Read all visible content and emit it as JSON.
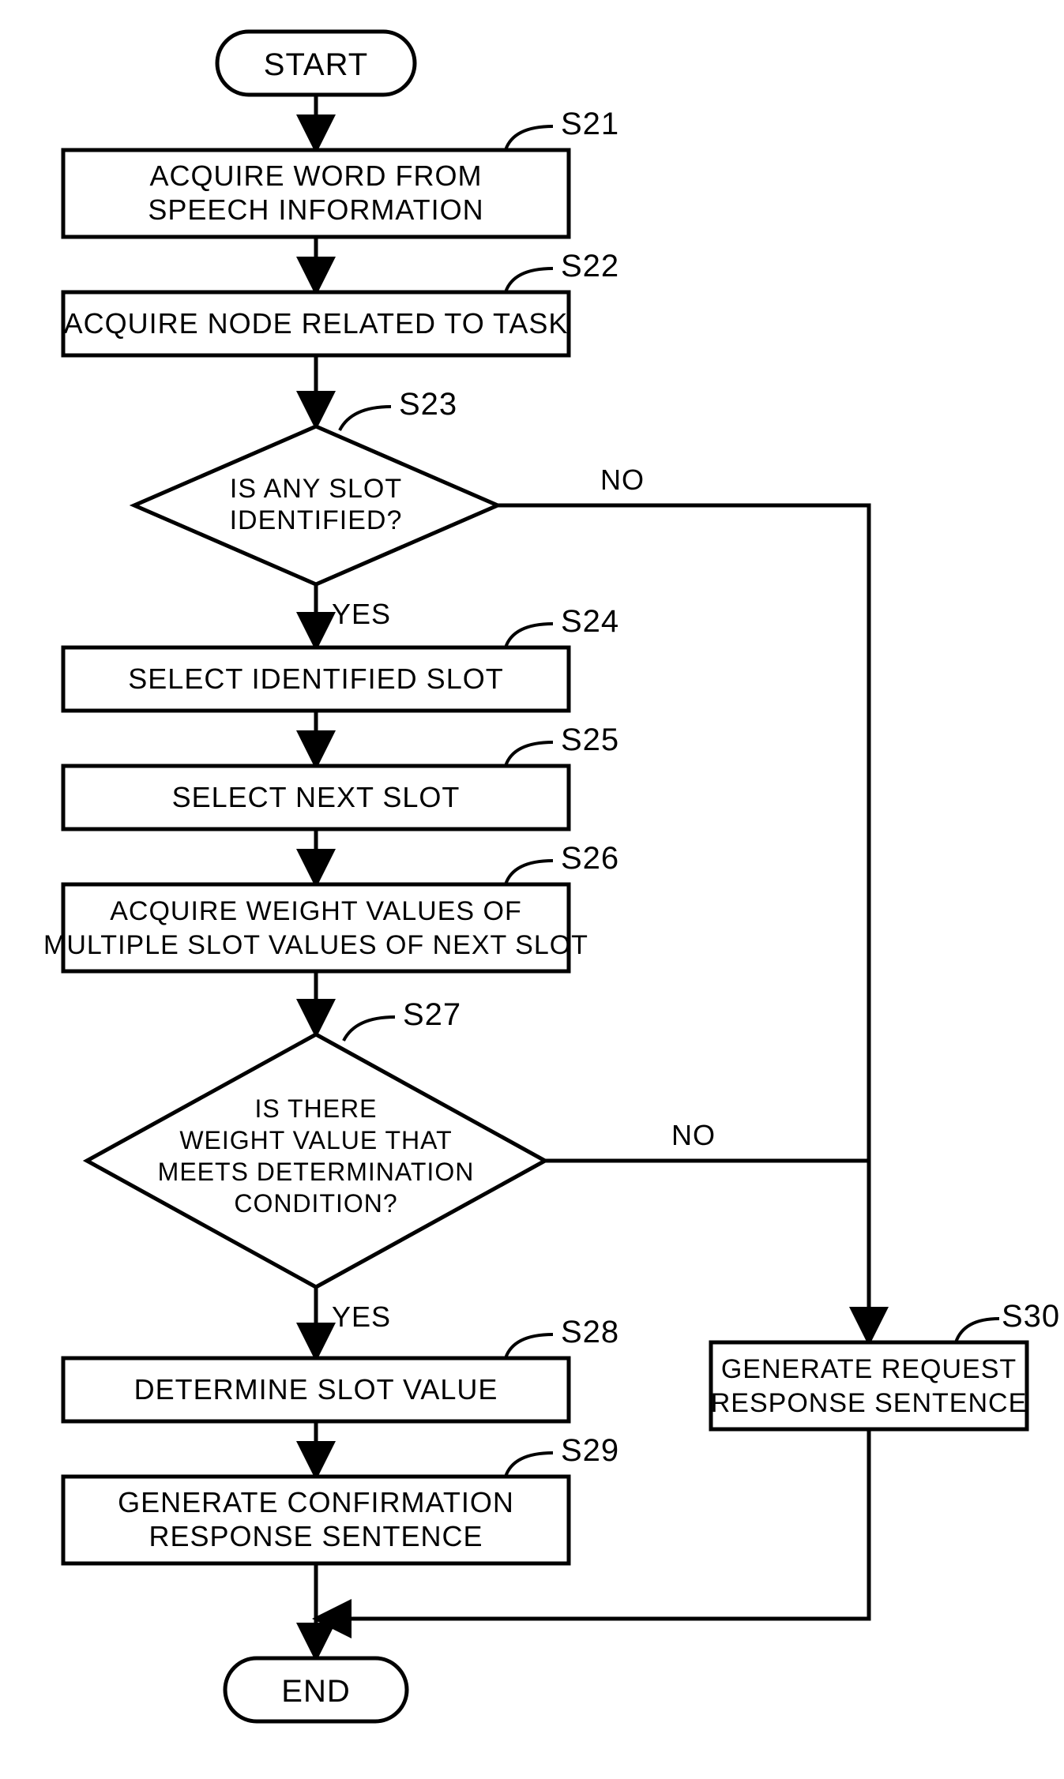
{
  "chart_data": {
    "type": "flowchart",
    "nodes": [
      {
        "id": "start",
        "kind": "terminator",
        "label": "START"
      },
      {
        "id": "s21",
        "kind": "process",
        "label": "S21",
        "text": "ACQUIRE WORD FROM SPEECH INFORMATION"
      },
      {
        "id": "s22",
        "kind": "process",
        "label": "S22",
        "text": "ACQUIRE NODE RELATED TO TASK"
      },
      {
        "id": "s23",
        "kind": "decision",
        "label": "S23",
        "text": "IS ANY SLOT IDENTIFIED?",
        "yes_to": "s24",
        "no_to": "s30"
      },
      {
        "id": "s24",
        "kind": "process",
        "label": "S24",
        "text": "SELECT IDENTIFIED SLOT"
      },
      {
        "id": "s25",
        "kind": "process",
        "label": "S25",
        "text": "SELECT NEXT SLOT"
      },
      {
        "id": "s26",
        "kind": "process",
        "label": "S26",
        "text": "ACQUIRE WEIGHT VALUES OF MULTIPLE SLOT VALUES OF NEXT SLOT"
      },
      {
        "id": "s27",
        "kind": "decision",
        "label": "S27",
        "text": "IS THERE WEIGHT VALUE THAT MEETS DETERMINATION CONDITION?",
        "yes_to": "s28",
        "no_to": "s30"
      },
      {
        "id": "s28",
        "kind": "process",
        "label": "S28",
        "text": "DETERMINE SLOT VALUE"
      },
      {
        "id": "s29",
        "kind": "process",
        "label": "S29",
        "text": "GENERATE CONFIRMATION RESPONSE SENTENCE"
      },
      {
        "id": "s30",
        "kind": "process",
        "label": "S30",
        "text": "GENERATE REQUEST RESPONSE SENTENCE"
      },
      {
        "id": "end",
        "kind": "terminator",
        "label": "END"
      }
    ],
    "edges": [
      [
        "start",
        "s21"
      ],
      [
        "s21",
        "s22"
      ],
      [
        "s22",
        "s23"
      ],
      [
        "s23",
        "s24",
        "YES"
      ],
      [
        "s23",
        "s30",
        "NO"
      ],
      [
        "s24",
        "s25"
      ],
      [
        "s25",
        "s26"
      ],
      [
        "s26",
        "s27"
      ],
      [
        "s27",
        "s28",
        "YES"
      ],
      [
        "s27",
        "s30",
        "NO"
      ],
      [
        "s28",
        "s29"
      ],
      [
        "s29",
        "end"
      ],
      [
        "s30",
        "end"
      ]
    ]
  },
  "terminator": {
    "start": "START",
    "end": "END"
  },
  "steps": {
    "s21": {
      "label": "S21",
      "line1": "ACQUIRE WORD FROM",
      "line2": "SPEECH INFORMATION"
    },
    "s22": {
      "label": "S22",
      "line1": "ACQUIRE NODE RELATED TO TASK"
    },
    "s23": {
      "label": "S23",
      "line1": "IS ANY SLOT",
      "line2": "IDENTIFIED?"
    },
    "s24": {
      "label": "S24",
      "line1": "SELECT IDENTIFIED SLOT"
    },
    "s25": {
      "label": "S25",
      "line1": "SELECT NEXT SLOT"
    },
    "s26": {
      "label": "S26",
      "line1": "ACQUIRE WEIGHT VALUES OF",
      "line2": "MULTIPLE SLOT VALUES OF NEXT SLOT"
    },
    "s27": {
      "label": "S27",
      "line1": "IS THERE",
      "line2": "WEIGHT VALUE THAT",
      "line3": "MEETS DETERMINATION",
      "line4": "CONDITION?"
    },
    "s28": {
      "label": "S28",
      "line1": "DETERMINE SLOT VALUE"
    },
    "s29": {
      "label": "S29",
      "line1": "GENERATE CONFIRMATION",
      "line2": "RESPONSE SENTENCE"
    },
    "s30": {
      "label": "S30",
      "line1": "GENERATE REQUEST",
      "line2": "RESPONSE SENTENCE"
    }
  },
  "branch": {
    "yes": "YES",
    "no": "NO"
  }
}
